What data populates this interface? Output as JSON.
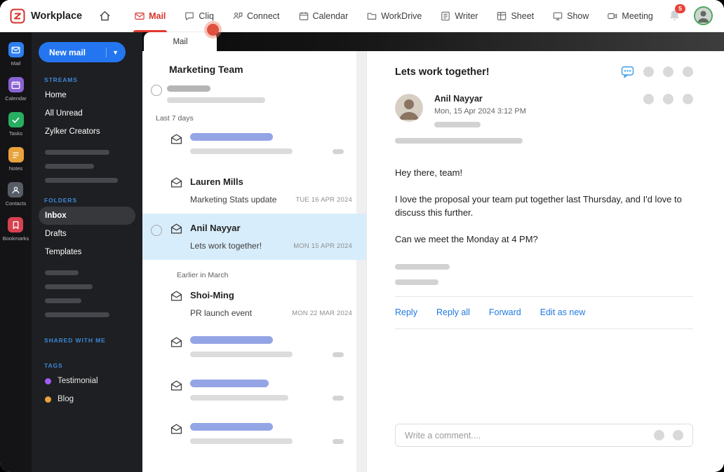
{
  "colors": {
    "accent_red": "#e0382e",
    "primary_blue": "#2476f0",
    "selected_mail_bg": "#d8edfb",
    "placeholder_blue": "#94a5e6",
    "link_blue": "#2179e0",
    "section_label_blue": "#3d87d8"
  },
  "topbar": {
    "brand": "Workplace",
    "nav_items": [
      {
        "label": "Mail",
        "active": true
      },
      {
        "label": "Cliq",
        "active": false
      },
      {
        "label": "Connect",
        "active": false
      },
      {
        "label": "Calendar",
        "active": false
      },
      {
        "label": "WorkDrive",
        "active": false
      },
      {
        "label": "Writer",
        "active": false
      },
      {
        "label": "Sheet",
        "active": false
      },
      {
        "label": "Show",
        "active": false
      },
      {
        "label": "Meeting",
        "active": false
      }
    ],
    "notification_badge": "5"
  },
  "app_rail": {
    "items": [
      {
        "label": "Mail",
        "color": "#2e7ef0"
      },
      {
        "label": "Calendar",
        "color": "#8a63d2"
      },
      {
        "label": "Tasks",
        "color": "#27ae60"
      },
      {
        "label": "Notes",
        "color": "#e8a33d"
      },
      {
        "label": "Contacts",
        "color": "#565d66"
      },
      {
        "label": "Bookmarks",
        "color": "#d6414f"
      }
    ]
  },
  "sidebar": {
    "new_mail_label": "New mail",
    "streams_label": "STREAMS",
    "streams": [
      {
        "label": "Home"
      },
      {
        "label": "All Unread"
      },
      {
        "label": "Zylker Creators"
      }
    ],
    "folders_label": "FOLDERS",
    "folders": [
      {
        "label": "Inbox",
        "selected": true
      },
      {
        "label": "Drafts",
        "selected": false
      },
      {
        "label": "Templates",
        "selected": false
      }
    ],
    "shared_label": "SHARED WITH ME",
    "tags_label": "TAGS",
    "tags": [
      {
        "label": "Testimonial",
        "color": "#a05df0"
      },
      {
        "label": "Blog",
        "color": "#e8a33d"
      }
    ]
  },
  "mail_list": {
    "tab_label": "Mail",
    "header": "Marketing Team",
    "groups": [
      {
        "label": "Last 7 days"
      },
      {
        "label": "Earlier in March"
      }
    ],
    "items": [
      {
        "sender": "Lauren Mills",
        "subject": "Marketing Stats update",
        "date": "TUE 16 APR 2024",
        "selected": false
      },
      {
        "sender": "Anil Nayyar",
        "subject": "Lets work together!",
        "date": "MON 15 APR 2024",
        "selected": true
      },
      {
        "sender": "Shoi-Ming",
        "subject": "PR launch event",
        "date": "MON 22 MAR 2024",
        "selected": false
      }
    ]
  },
  "reading_pane": {
    "subject": "Lets work together!",
    "sender_name": "Anil Nayyar",
    "sent_datetime": "Mon, 15 Apr 2024  3:12 PM",
    "body_paragraphs": [
      "Hey there, team!",
      "I love the proposal your team put together last Thursday, and I'd love to discuss this further.",
      "Can we meet the Monday at 4 PM?"
    ],
    "actions": [
      {
        "label": "Reply"
      },
      {
        "label": "Reply all"
      },
      {
        "label": "Forward"
      },
      {
        "label": "Edit as new"
      }
    ],
    "comment_placeholder": "Write a comment...."
  }
}
